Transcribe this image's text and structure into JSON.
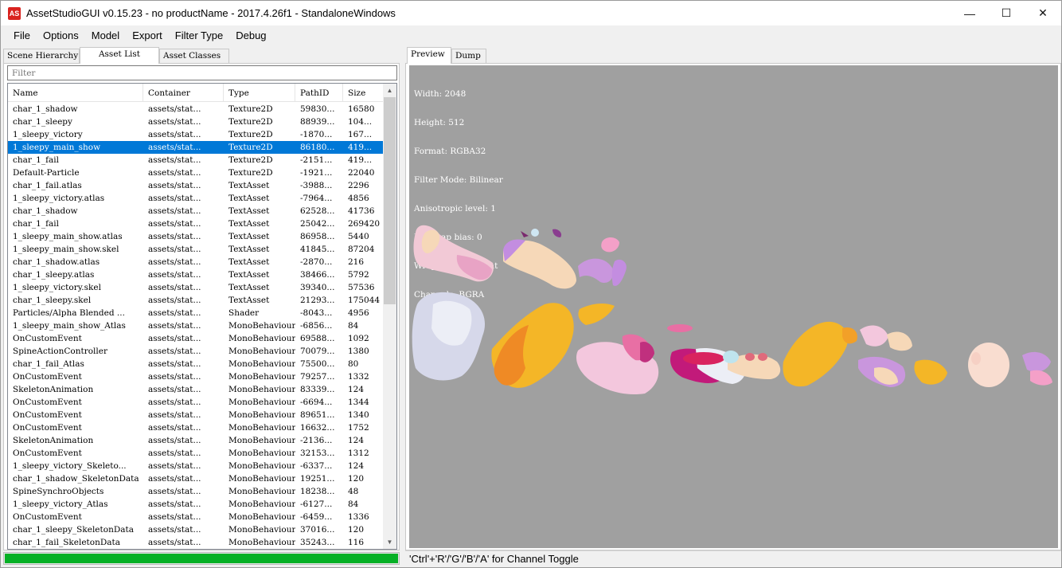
{
  "window": {
    "icon_text": "AS",
    "title": "AssetStudioGUI v0.15.23 - no productName - 2017.4.26f1 - StandaloneWindows",
    "minimize": "—",
    "maximize": "☐",
    "close": "✕"
  },
  "menu": [
    "File",
    "Options",
    "Model",
    "Export",
    "Filter Type",
    "Debug"
  ],
  "left_tabs": {
    "scene_hierarchy": "Scene Hierarchy",
    "asset_list": "Asset List",
    "asset_classes": "Asset Classes"
  },
  "filter": {
    "placeholder": "Filter"
  },
  "columns": [
    "Name",
    "Container",
    "Type",
    "PathID",
    "Size"
  ],
  "rows": [
    [
      "char_1_shadow",
      "assets/stat...",
      "Texture2D",
      "59830...",
      "16580"
    ],
    [
      "char_1_sleepy",
      "assets/stat...",
      "Texture2D",
      "88939...",
      "104..."
    ],
    [
      "1_sleepy_victory",
      "assets/stat...",
      "Texture2D",
      "-1870...",
      "167..."
    ],
    [
      "1_sleepy_main_show",
      "assets/stat...",
      "Texture2D",
      "86180...",
      "419..."
    ],
    [
      "char_1_fail",
      "assets/stat...",
      "Texture2D",
      "-2151...",
      "419..."
    ],
    [
      "Default-Particle",
      "assets/stat...",
      "Texture2D",
      "-1921...",
      "22040"
    ],
    [
      "char_1_fail.atlas",
      "assets/stat...",
      "TextAsset",
      "-3988...",
      "2296"
    ],
    [
      "1_sleepy_victory.atlas",
      "assets/stat...",
      "TextAsset",
      "-7964...",
      "4856"
    ],
    [
      "char_1_shadow",
      "assets/stat...",
      "TextAsset",
      "62528...",
      "41736"
    ],
    [
      "char_1_fail",
      "assets/stat...",
      "TextAsset",
      "25042...",
      "269420"
    ],
    [
      "1_sleepy_main_show.atlas",
      "assets/stat...",
      "TextAsset",
      "86958...",
      "5440"
    ],
    [
      "1_sleepy_main_show.skel",
      "assets/stat...",
      "TextAsset",
      "41845...",
      "87204"
    ],
    [
      "char_1_shadow.atlas",
      "assets/stat...",
      "TextAsset",
      "-2870...",
      "216"
    ],
    [
      "char_1_sleepy.atlas",
      "assets/stat...",
      "TextAsset",
      "38466...",
      "5792"
    ],
    [
      "1_sleepy_victory.skel",
      "assets/stat...",
      "TextAsset",
      "39340...",
      "57536"
    ],
    [
      "char_1_sleepy.skel",
      "assets/stat...",
      "TextAsset",
      "21293...",
      "175044"
    ],
    [
      "Particles/Alpha Blended ...",
      "assets/stat...",
      "Shader",
      "-8043...",
      "4956"
    ],
    [
      "1_sleepy_main_show_Atlas",
      "assets/stat...",
      "MonoBehaviour",
      "-6856...",
      "84"
    ],
    [
      "OnCustomEvent",
      "assets/stat...",
      "MonoBehaviour",
      "69588...",
      "1092"
    ],
    [
      "SpineActionController",
      "assets/stat...",
      "MonoBehaviour",
      "70079...",
      "1380"
    ],
    [
      "char_1_fail_Atlas",
      "assets/stat...",
      "MonoBehaviour",
      "75500...",
      "80"
    ],
    [
      "OnCustomEvent",
      "assets/stat...",
      "MonoBehaviour",
      "79257...",
      "1332"
    ],
    [
      "SkeletonAnimation",
      "assets/stat...",
      "MonoBehaviour",
      "83339...",
      "124"
    ],
    [
      "OnCustomEvent",
      "assets/stat...",
      "MonoBehaviour",
      "-6694...",
      "1344"
    ],
    [
      "OnCustomEvent",
      "assets/stat...",
      "MonoBehaviour",
      "89651...",
      "1340"
    ],
    [
      "OnCustomEvent",
      "assets/stat...",
      "MonoBehaviour",
      "16632...",
      "1752"
    ],
    [
      "SkeletonAnimation",
      "assets/stat...",
      "MonoBehaviour",
      "-2136...",
      "124"
    ],
    [
      "OnCustomEvent",
      "assets/stat...",
      "MonoBehaviour",
      "32153...",
      "1312"
    ],
    [
      "1_sleepy_victory_Skeleto...",
      "assets/stat...",
      "MonoBehaviour",
      "-6337...",
      "124"
    ],
    [
      "char_1_shadow_SkeletonData",
      "assets/stat...",
      "MonoBehaviour",
      "19251...",
      "120"
    ],
    [
      "SpineSynchroObjects",
      "assets/stat...",
      "MonoBehaviour",
      "18238...",
      "48"
    ],
    [
      "1_sleepy_victory_Atlas",
      "assets/stat...",
      "MonoBehaviour",
      "-6127...",
      "84"
    ],
    [
      "OnCustomEvent",
      "assets/stat...",
      "MonoBehaviour",
      "-6459...",
      "1336"
    ],
    [
      "char_1_sleepy_SkeletonData",
      "assets/stat...",
      "MonoBehaviour",
      "37016...",
      "120"
    ],
    [
      "char_1_fail_SkeletonData",
      "assets/stat...",
      "MonoBehaviour",
      "35243...",
      "116"
    ]
  ],
  "selected_row": 3,
  "progress": {
    "fraction": 1.0,
    "color": "#06b025"
  },
  "right_tabs": {
    "preview": "Preview",
    "dump": "Dump"
  },
  "texture_info": [
    "Width: 2048",
    "Height: 512",
    "Format: RGBA32",
    "Filter Mode: Bilinear",
    "Anisotropic level: 1",
    "Mip map bias: 0",
    "Wrap mode: Repeat",
    "Channels: BGRA"
  ],
  "status": "'Ctrl'+'R'/'G'/'B'/'A' for Channel Toggle",
  "colors": {
    "selection": "#0078d7",
    "preview_bg": "#a0a0a0",
    "accent_red": "#d9231f"
  }
}
